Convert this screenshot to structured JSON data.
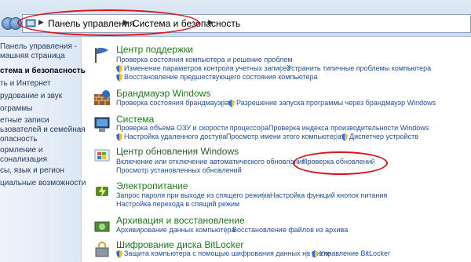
{
  "breadcrumb": [
    "Панель управления",
    "Система и безопасность"
  ],
  "sidebar": {
    "items": [
      {
        "label": "Панель управления -",
        "active": false
      },
      {
        "label": "машняя страница",
        "active": false
      },
      {
        "label": "стема и безопасность",
        "active": true
      },
      {
        "label": "ть и Интернет",
        "active": false
      },
      {
        "label": "рудование и звук",
        "active": false
      },
      {
        "label": "ограммы",
        "active": false
      },
      {
        "label": "етные записи",
        "active": false
      },
      {
        "label": "ьзователей и семейная",
        "active": false
      },
      {
        "label": "опасность",
        "active": false
      },
      {
        "label": "ормление и",
        "active": false
      },
      {
        "label": "сонализация",
        "active": false
      },
      {
        "label": "сы, язык и регион",
        "active": false
      },
      {
        "label": "циальные возможности",
        "active": false
      }
    ]
  },
  "categories": [
    {
      "title": "Центр поддержки",
      "icon": "flag-icon",
      "rows": [
        [
          "Проверка состояния компьютера и решение проблем"
        ],
        [
          "Изменение параметров контроля учетных записей",
          "Устранить типичные проблемы компьютера"
        ],
        [
          "Восстановление предшествующего состояния компьютера"
        ]
      ]
    },
    {
      "title": "Брандмауэр Windows",
      "icon": "firewall-icon",
      "rows": [
        [
          "Проверка состояния брандмауэра",
          "Разрешение запуска программы через брандмауэр Windows"
        ]
      ]
    },
    {
      "title": "Система",
      "icon": "computer-icon",
      "rows": [
        [
          "Проверка объема ОЗУ и скорости процессора",
          "Проверка индекса производительности Windows"
        ],
        [
          "Настройка удаленного доступа",
          "Просмотр имени этого компьютера",
          "Диспетчер устройств"
        ]
      ]
    },
    {
      "title": "Центр обновления Windows",
      "icon": "windows-update-icon",
      "rows": [
        [
          "Включение или отключение автоматического обновления",
          "Проверка обновлений"
        ],
        [
          "Просмотр установленных обновлений"
        ]
      ]
    },
    {
      "title": "Электропитание",
      "icon": "power-icon",
      "rows": [
        [
          "Запрос пароля при выходе из спящего режима",
          "Настройка функций кнопок питания"
        ],
        [
          "Настройка перехода в спящий режим"
        ]
      ]
    },
    {
      "title": "Архивация и восстановление",
      "icon": "backup-icon",
      "rows": [
        [
          "Архивирование данных компьютера",
          "Восстановление файлов из архива"
        ]
      ]
    },
    {
      "title": "Шифрование диска BitLocker",
      "icon": "bitlocker-icon",
      "rows": [
        [
          "Защита компьютера с помощью шифрования данных на диске",
          "Управление BitLocker"
        ]
      ]
    }
  ],
  "colors": {
    "link": "#1f4e99",
    "title": "#1e7b1e",
    "annotation": "#d9141b"
  }
}
